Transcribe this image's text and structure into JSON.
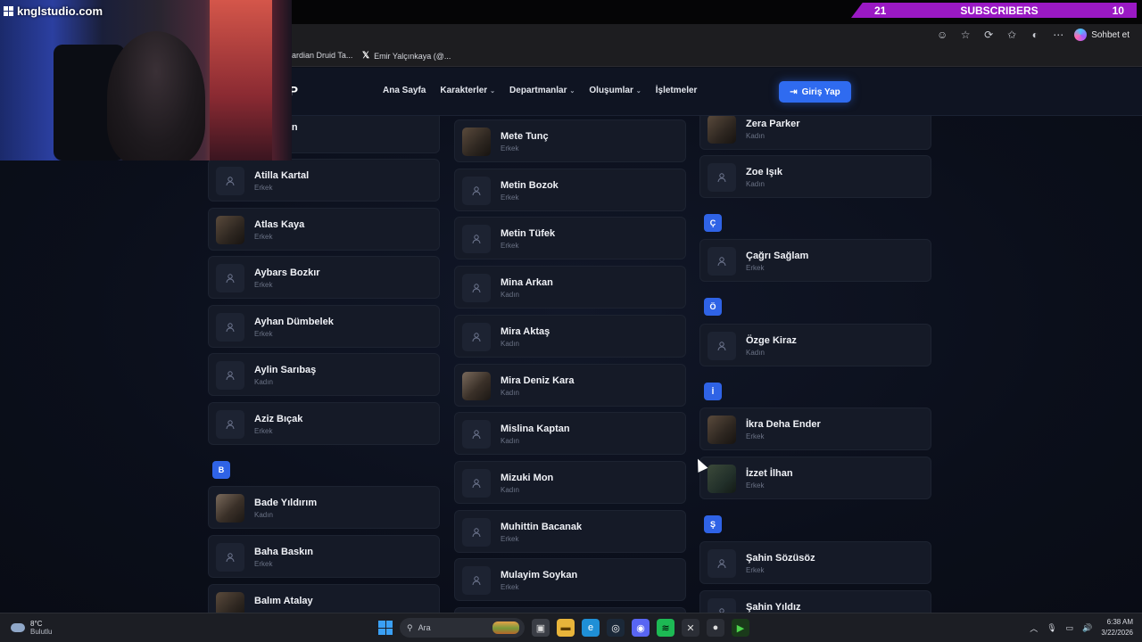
{
  "stream_overlay": {
    "watermark": "knglstudio.com",
    "subs_left": "21",
    "subs_label": "SUBSCRIBERS",
    "subs_right": "10"
  },
  "browser": {
    "copilot_label": "Sohbet et",
    "favorites": [
      "ardian Druid Ta...",
      "Emir Yalçınkaya (@..."
    ]
  },
  "site": {
    "logo_fragment": "P",
    "nav": [
      {
        "label": "Ana Sayfa",
        "dropdown": false
      },
      {
        "label": "Karakterler",
        "dropdown": true
      },
      {
        "label": "Departmanlar",
        "dropdown": true
      },
      {
        "label": "Oluşumlar",
        "dropdown": true
      },
      {
        "label": "İşletmeler",
        "dropdown": false
      }
    ],
    "login_label": "Giriş Yap"
  },
  "columns": {
    "left": {
      "cropped_name": "dan",
      "cards": [
        {
          "name": "Atilla Kartal",
          "gender": "Erkek",
          "photo": false
        },
        {
          "name": "Atlas Kaya",
          "gender": "Erkek",
          "photo": true
        },
        {
          "name": "Aybars Bozkır",
          "gender": "Erkek",
          "photo": false
        },
        {
          "name": "Ayhan Dümbelek",
          "gender": "Erkek",
          "photo": false
        },
        {
          "name": "Aylin Sarıbaş",
          "gender": "Kadın",
          "photo": false
        },
        {
          "name": "Aziz Bıçak",
          "gender": "Erkek",
          "photo": false
        }
      ],
      "letter": "B",
      "cards_b": [
        {
          "name": "Bade Yıldırım",
          "gender": "Kadın",
          "photo": true
        },
        {
          "name": "Baha Baskın",
          "gender": "Erkek",
          "photo": false
        },
        {
          "name": "Balım Atalay",
          "gender": "",
          "photo": true
        }
      ]
    },
    "middle": {
      "cards": [
        {
          "name": "Mete Tunç",
          "gender": "Erkek",
          "photo": true
        },
        {
          "name": "Metin Bozok",
          "gender": "Erkek",
          "photo": false
        },
        {
          "name": "Metin Tüfek",
          "gender": "Erkek",
          "photo": false
        },
        {
          "name": "Mina Arkan",
          "gender": "Kadın",
          "photo": false
        },
        {
          "name": "Mira Aktaş",
          "gender": "Kadın",
          "photo": false
        },
        {
          "name": "Mira Deniz Kara",
          "gender": "Kadın",
          "photo": true
        },
        {
          "name": "Mislina Kaptan",
          "gender": "Kadın",
          "photo": false
        },
        {
          "name": "Mizuki Mon",
          "gender": "Kadın",
          "photo": false
        },
        {
          "name": "Muhittin Bacanak",
          "gender": "Erkek",
          "photo": false
        },
        {
          "name": "Mulayim Soykan",
          "gender": "Erkek",
          "photo": false
        }
      ]
    },
    "right": {
      "cards_top": [
        {
          "name": "Zera Parker",
          "gender": "Kadın",
          "photo": true
        },
        {
          "name": "Zoe Işık",
          "gender": "Kadın",
          "photo": false
        }
      ],
      "letter_c": "Ç",
      "cards_c": [
        {
          "name": "Çağrı Sağlam",
          "gender": "Erkek",
          "photo": false
        }
      ],
      "letter_o": "Ö",
      "cards_o": [
        {
          "name": "Özge Kiraz",
          "gender": "Kadın",
          "photo": false
        }
      ],
      "letter_i": "İ",
      "cards_i": [
        {
          "name": "İkra Deha Ender",
          "gender": "Erkek",
          "photo": true
        },
        {
          "name": "İzzet İlhan",
          "gender": "Erkek",
          "photo": true
        }
      ],
      "letter_s": "Ş",
      "cards_s": [
        {
          "name": "Şahin Sözüsöz",
          "gender": "Erkek",
          "photo": false
        },
        {
          "name": "Şahin Yıldız",
          "gender": "",
          "photo": false
        }
      ]
    }
  },
  "taskbar": {
    "temperature": "8°C",
    "weather": "Bulutlu",
    "search_placeholder": "Ara",
    "time": "6:38 AM",
    "date": "3/22/2026"
  }
}
